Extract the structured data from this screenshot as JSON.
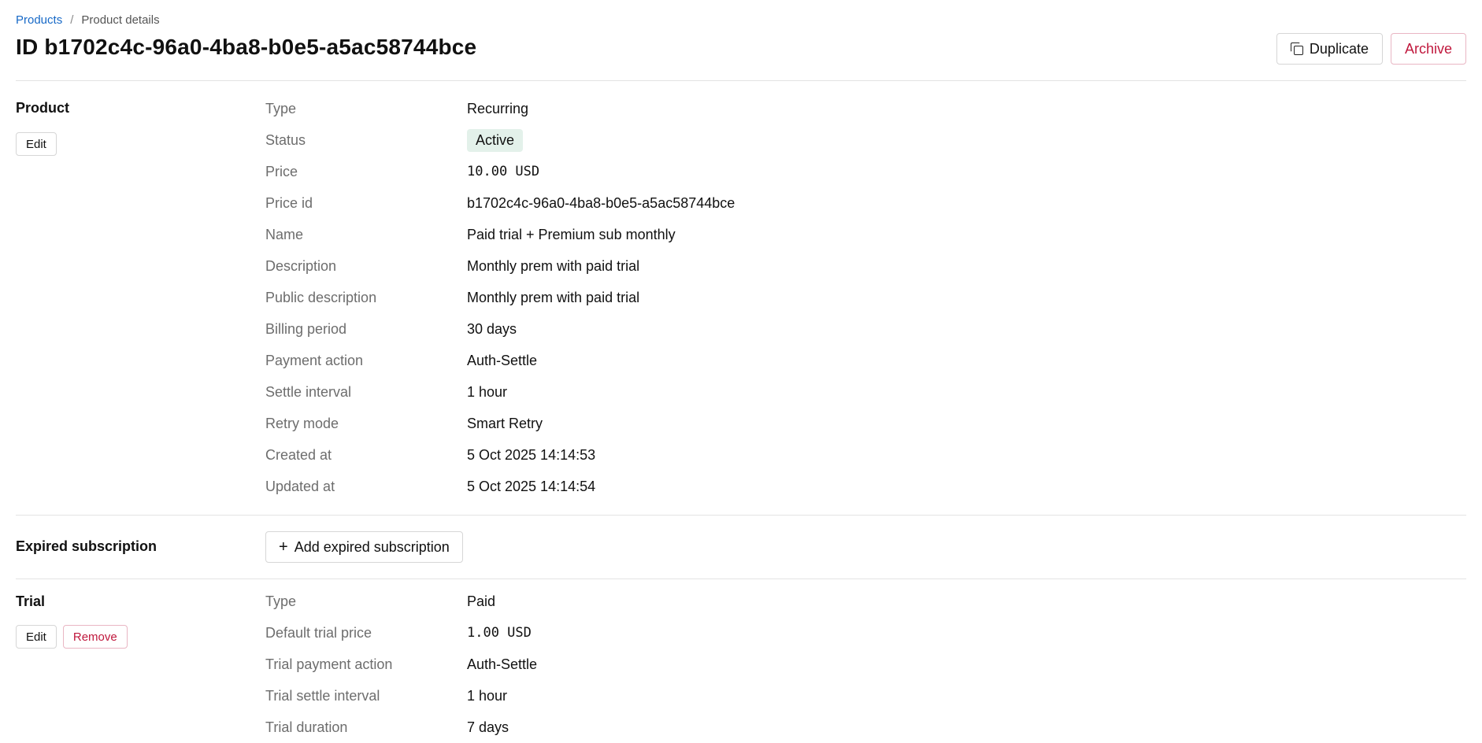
{
  "breadcrumb": {
    "root": "Products",
    "separator": "/",
    "current": "Product details"
  },
  "title": "ID b1702c4c-96a0-4ba8-b0e5-a5ac58744bce",
  "header_actions": {
    "duplicate": "Duplicate",
    "archive": "Archive"
  },
  "product": {
    "heading": "Product",
    "edit_label": "Edit",
    "rows": [
      {
        "label": "Type",
        "value": "Recurring"
      },
      {
        "label": "Status",
        "value": "Active"
      },
      {
        "label": "Price",
        "value": "10.00 USD"
      },
      {
        "label": "Price id",
        "value": "b1702c4c-96a0-4ba8-b0e5-a5ac58744bce"
      },
      {
        "label": "Name",
        "value": "Paid trial + Premium sub monthly"
      },
      {
        "label": "Description",
        "value": "Monthly prem with paid trial"
      },
      {
        "label": "Public description",
        "value": "Monthly prem with paid trial"
      },
      {
        "label": "Billing period",
        "value": "30 days"
      },
      {
        "label": "Payment action",
        "value": "Auth-Settle"
      },
      {
        "label": "Settle interval",
        "value": "1 hour"
      },
      {
        "label": "Retry mode",
        "value": "Smart Retry"
      },
      {
        "label": "Created at",
        "value": "5 Oct 2025 14:14:53"
      },
      {
        "label": "Updated at",
        "value": "5 Oct 2025 14:14:54"
      }
    ]
  },
  "expired_subscription": {
    "heading": "Expired subscription",
    "add_label": "Add expired subscription"
  },
  "trial": {
    "heading": "Trial",
    "edit_label": "Edit",
    "remove_label": "Remove",
    "rows": [
      {
        "label": "Type",
        "value": "Paid"
      },
      {
        "label": "Default trial price",
        "value": "1.00 USD"
      },
      {
        "label": "Trial payment action",
        "value": "Auth-Settle"
      },
      {
        "label": "Trial settle interval",
        "value": "1 hour"
      },
      {
        "label": "Trial duration",
        "value": "7 days"
      }
    ]
  },
  "colors": {
    "link": "#1769c7",
    "danger": "#c0183d",
    "badge_bg": "#e3f1ea",
    "badge_text": "#135a3a",
    "label": "#6d6d6d",
    "divider": "#e3e3e3"
  }
}
